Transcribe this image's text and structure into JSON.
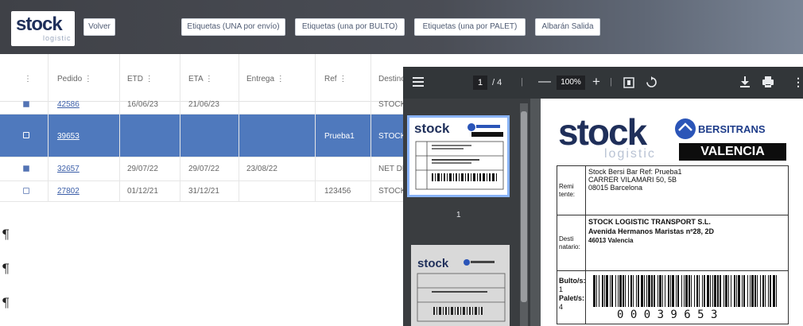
{
  "topbar": {
    "logo_word": "stock",
    "logo_sub": "logistic",
    "buttons": [
      "Volver",
      "Etiquetas (UNA por envío)",
      "Etiquetas (una por BULTO)",
      "Etiquetas (una por PALET)",
      "Albarán Salida"
    ]
  },
  "table": {
    "headers": [
      "⋮",
      "Pedido ⋮",
      "ETD ⋮",
      "ETA ⋮",
      "Entrega ⋮",
      "Ref ⋮",
      "Destino"
    ],
    "rows": [
      {
        "pedido": "42586",
        "etd": "16/06/23",
        "eta": "21/06/23",
        "entrega": "",
        "ref": "",
        "destino": "STOCK",
        "checked": true,
        "selected": false
      },
      {
        "pedido": "39653",
        "etd": "",
        "eta": "",
        "entrega": "",
        "ref": "Prueba1",
        "destino": "STOCK",
        "checked": true,
        "selected": true
      },
      {
        "pedido": "32657",
        "etd": "29/07/22",
        "eta": "29/07/22",
        "entrega": "23/08/22",
        "ref": "",
        "destino": "NET DE",
        "checked": true,
        "selected": false
      },
      {
        "pedido": "27802",
        "etd": "01/12/21",
        "eta": "31/12/21",
        "entrega": "",
        "ref": "123456",
        "destino": "STOCK",
        "checked": false,
        "selected": false
      }
    ]
  },
  "pilcrow": "¶",
  "viewer": {
    "page_current": "1",
    "page_sep": "/ 4",
    "zoom": "100%",
    "thumb_label": "1",
    "label": {
      "brand": "stock",
      "brand_sub": "logistic",
      "partner": "BERSITRANS",
      "city": "VALENCIA",
      "remitente_label": "Remi tente:",
      "remitente_lines": [
        "Stock Bersi Bar Ref: Prueba1",
        "CARRER VILAMARI 50, 5B",
        "08015 Barcelona"
      ],
      "destinatario_label": "Desti natario:",
      "destinatario_lines": [
        "STOCK LOGISTIC TRANSPORT S.L.",
        "Avenida Hermanos Maristas nº28, 2D",
        "46013 Valencia"
      ],
      "bultos_label": "Bulto/s:",
      "bultos_value": "1",
      "palets_label": "Palet/s:",
      "palets_value": "4",
      "barcode_text": "0 0 0 3 9 6 5 3"
    }
  }
}
